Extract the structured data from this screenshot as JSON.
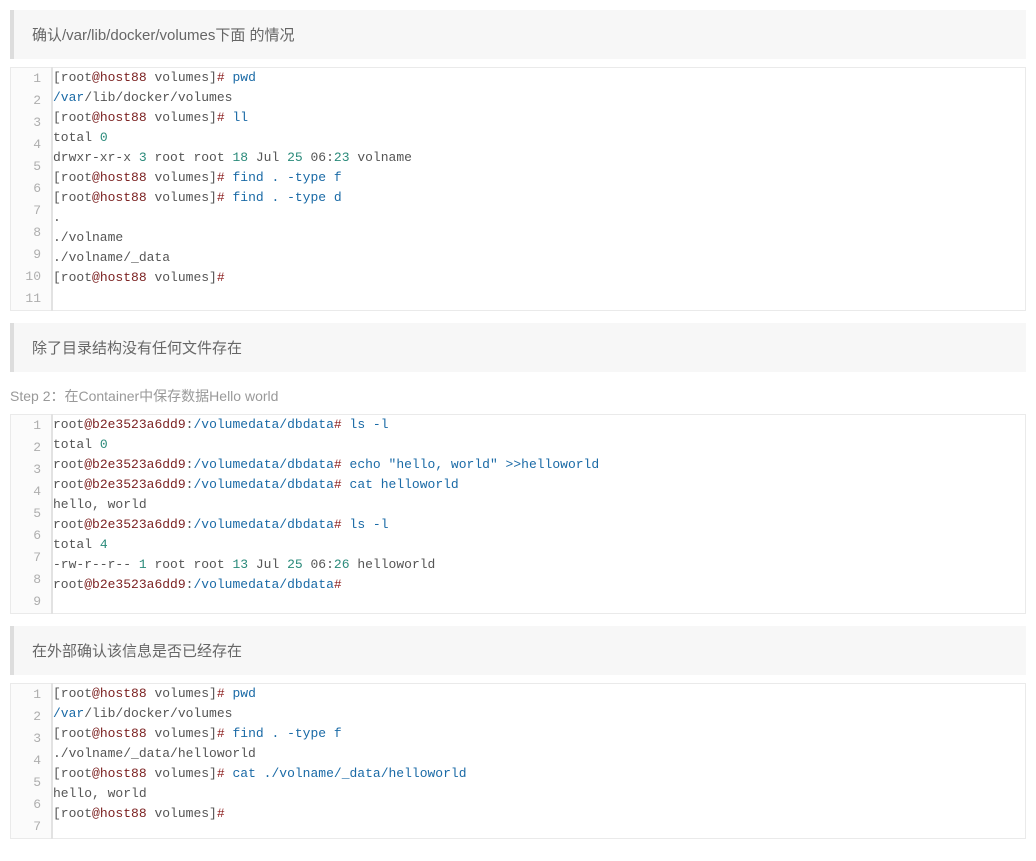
{
  "quotes": {
    "q1": "确认/var/lib/docker/volumes下面 的情况",
    "q2": "除了目录结构没有任何文件存在",
    "q3": "在外部确认该信息是否已经存在"
  },
  "step": "Step 2：在Container中保存数据Hello world",
  "tokens": {
    "root_open": "[root",
    "root_bare": "root",
    "at": "@",
    "host88": "host88",
    "volumes_dir": " volumes]",
    "hash": "#",
    "pwd": " pwd",
    "ll": " ll",
    "find_f": " find . -type f",
    "find_d": " find . -type d",
    "ls_l": " ls -l",
    "echo_hw": " echo \"hello, world\" >>helloworld",
    "cat_hw": " cat helloworld",
    "cat_vol_hw": " cat ./volname/_data/helloworld",
    "container": "b2e3523a6dd9",
    "colon": ":",
    "slash": "/",
    "vol_db": "volumedata/dbdata",
    "total": "total ",
    "zero": "0",
    "four": "4",
    "perm_d": "drwxr-xr-x ",
    "perm_f": "-rw-r--r-- ",
    "one": "1",
    "three": "3",
    "root_root": " root root ",
    "n18": "18",
    "n13": "13",
    "jul": " Jul ",
    "n25": "25",
    "sp06": " 06:",
    "n23": "23",
    "n26": "26",
    "volname_tail": " volname",
    "helloworld_tail": " helloworld",
    "hw_text": "hello, world",
    "slash_var": "/var",
    "lib_docker_volumes": "/lib/docker/volumes",
    "dot": ".",
    "dot_volname": "./volname",
    "dot_volname_data": "./volname/_data",
    "dot_volname_data_hw": "./volname/_data/helloworld"
  }
}
